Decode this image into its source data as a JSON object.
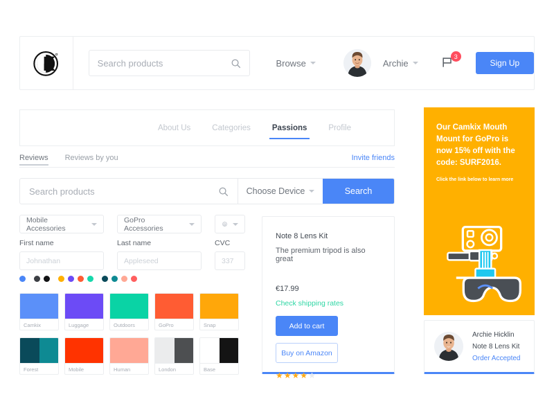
{
  "header": {
    "logo_alt": "Camkix logo",
    "search": {
      "placeholder": "Search products",
      "value": ""
    },
    "browse_label": "Browse",
    "user_name": "Archie",
    "notifications_count": "3",
    "signup_label": "Sign Up"
  },
  "tabs": [
    {
      "label": "About Us",
      "active": false
    },
    {
      "label": "Categories",
      "active": false
    },
    {
      "label": "Passions",
      "active": true
    },
    {
      "label": "Profile",
      "active": false
    }
  ],
  "subtabs": [
    {
      "label": "Reviews",
      "active": true
    },
    {
      "label": "Reviews by you",
      "active": false
    }
  ],
  "invite_label": "Invite friends",
  "search_row": {
    "placeholder": "Search products",
    "value": "",
    "device_label": "Choose Device",
    "button_label": "Search"
  },
  "selects": {
    "category_1": "Mobile Accessories",
    "category_2": "GoPro Accessories",
    "settings_icon": "gear-icon"
  },
  "form": {
    "first_name": {
      "label": "First name",
      "placeholder": "Johnathan",
      "value": ""
    },
    "last_name": {
      "label": "Last name",
      "placeholder": "Appleseed",
      "value": ""
    },
    "cvc": {
      "label": "CVC",
      "placeholder": "337",
      "value": ""
    }
  },
  "dots": [
    {
      "name": "blue",
      "color": "#4a86f7"
    },
    {
      "name": "dark-gray",
      "color": "#3c3f44"
    },
    {
      "name": "black",
      "color": "#111214"
    },
    {
      "name": "amber",
      "color": "#ffb000"
    },
    {
      "name": "violet",
      "color": "#6c4bf6"
    },
    {
      "name": "orange-red",
      "color": "#ff5c33"
    },
    {
      "name": "mint",
      "color": "#16d8ab"
    },
    {
      "name": "deep-teal",
      "color": "#0a4a5a"
    },
    {
      "name": "teal",
      "color": "#0e8a93"
    },
    {
      "name": "salmon",
      "color": "#ffa895"
    },
    {
      "name": "coral",
      "color": "#ff5e5e"
    }
  ],
  "swatches": [
    {
      "name": "Camkix",
      "colors": [
        "#5b90f9"
      ]
    },
    {
      "name": "Luggage",
      "colors": [
        "#6c4bf6"
      ]
    },
    {
      "name": "Outdoors",
      "colors": [
        "#0ad3a5"
      ]
    },
    {
      "name": "GoPro",
      "colors": [
        "#ff5c33"
      ]
    },
    {
      "name": "Snap",
      "colors": [
        "#ffa70a"
      ]
    },
    {
      "name": "Forest",
      "colors": [
        "#0a4a5a",
        "#0e8a93"
      ]
    },
    {
      "name": "Mobile",
      "colors": [
        "#ff3300"
      ]
    },
    {
      "name": "Human",
      "colors": [
        "#ffa895"
      ]
    },
    {
      "name": "London",
      "colors": [
        "#ebeced",
        "#4d4f51"
      ]
    },
    {
      "name": "Base",
      "colors": [
        "#ffffff",
        "#141414"
      ]
    }
  ],
  "product": {
    "title": "Note 8 Lens Kit",
    "subtitle": "The premium tripod is also great",
    "price": "€17.99",
    "shipping_link": "Check shipping rates",
    "add_to_cart_label": "Add to cart",
    "amazon_label": "Buy on Amazon",
    "rating": 4,
    "rating_max": 5,
    "accent_color": "#4a86f7"
  },
  "promo": {
    "headline": "Our Camkix Mouth Mount for GoPro is now 15% off with the code: SURF2016.",
    "subtext": "Click the link below to learn more",
    "background": "#ffb000",
    "art": "gopro-mouth-mount-illustration"
  },
  "review": {
    "name": "Archie Hicklin",
    "product": "Note 8 Lens Kit",
    "status": "Order Accepted",
    "accent_color": "#4a86f7"
  }
}
